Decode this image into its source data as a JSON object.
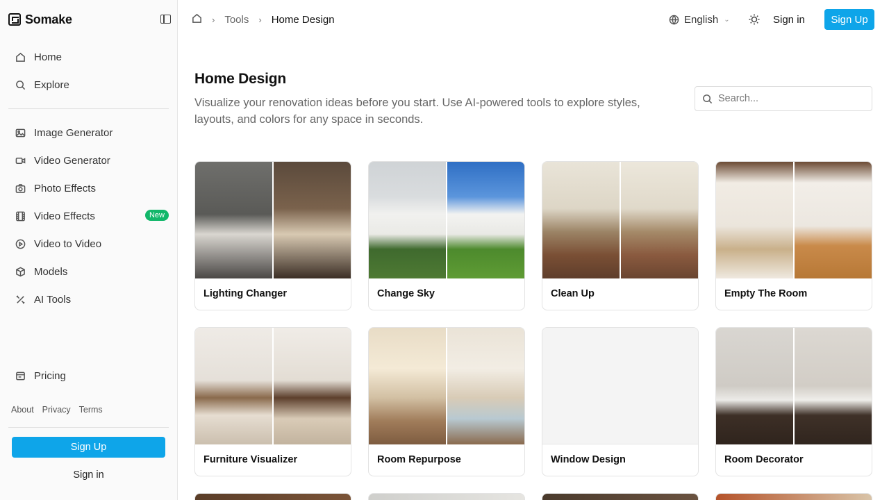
{
  "brand": {
    "name": "Somake"
  },
  "sidebar": {
    "nav_top": [
      {
        "label": "Home",
        "icon": "home-icon"
      },
      {
        "label": "Explore",
        "icon": "search-icon"
      }
    ],
    "nav_tools": [
      {
        "label": "Image Generator",
        "icon": "image-icon"
      },
      {
        "label": "Video Generator",
        "icon": "video-icon"
      },
      {
        "label": "Photo Effects",
        "icon": "camera-icon"
      },
      {
        "label": "Video Effects",
        "icon": "film-icon",
        "badge": "New"
      },
      {
        "label": "Video to Video",
        "icon": "play-circle-icon"
      },
      {
        "label": "Models",
        "icon": "cube-icon"
      },
      {
        "label": "AI Tools",
        "icon": "tools-icon"
      }
    ],
    "pricing": {
      "label": "Pricing",
      "icon": "receipt-icon"
    },
    "footer_links": [
      "About",
      "Privacy",
      "Terms"
    ],
    "signup_label": "Sign Up",
    "signin_label": "Sign in"
  },
  "topbar": {
    "breadcrumb": [
      "Tools",
      "Home Design"
    ],
    "language": "English",
    "signin_label": "Sign in",
    "signup_label": "Sign Up"
  },
  "page": {
    "title": "Home Design",
    "description": "Visualize your renovation ideas before you start. Use AI-powered tools to explore styles, layouts, and colors for any space in seconds.",
    "search_placeholder": "Search..."
  },
  "cards": [
    {
      "label": "Lighting Changer"
    },
    {
      "label": "Change Sky"
    },
    {
      "label": "Clean Up"
    },
    {
      "label": "Empty The Room"
    },
    {
      "label": "Furniture Visualizer"
    },
    {
      "label": "Room Repurpose"
    },
    {
      "label": "Window Design"
    },
    {
      "label": "Room Decorator"
    }
  ],
  "colors": {
    "accent": "#0ea5e9",
    "badge": "#12b76a"
  }
}
